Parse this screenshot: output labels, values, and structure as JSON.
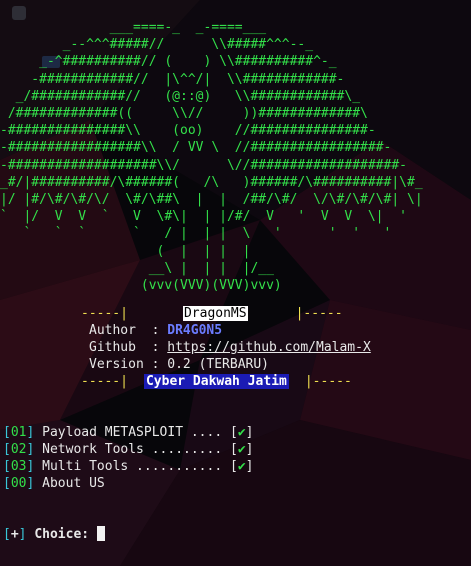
{
  "banner": {
    "art_lines": [
      "              ___====-_  _-====___",
      "        _--^^^#####//      \\\\#####^^^--_",
      "     _-^##########// (    ) \\\\##########^-_",
      "    -############//  |\\^^/|  \\\\############-",
      "  _/############//   (@::@)   \\\\############\\_",
      " /#############((     \\\\//     ))#############\\",
      "-###############\\\\    (oo)    //###############-",
      "-#################\\\\  / VV \\  //#################-",
      "-###################\\\\/      \\//###################-",
      "_#/|##########/\\######(   /\\   )######/\\##########|\\#_",
      "|/ |#/\\#/\\#/\\/  \\#/\\##\\  |  |  /##/\\#/  \\/\\#/\\#/\\#| \\|",
      "`  |/  V  V  `   V  \\#\\|  | |/#/  V   '  V  V  \\|  '",
      "   `   `  `      `   / |  | |  \\   '      '  '   '",
      "                    (  |  | |  |",
      "                   __\\ |  | |  |/__",
      "                  (vvv(VVV)(VVV)vvv)"
    ]
  },
  "info": {
    "dash_left": "-----|",
    "dash_right": "|-----",
    "title": "DragonMS",
    "author_label": "Author  : ",
    "author_value": "DR4G0N5",
    "github_label": "Github  : ",
    "github_value": "https://github.com/Malam-X",
    "version_text": "Version : 0.2 (TERBARU)",
    "team": "Cyber Dakwah Jatim"
  },
  "menu": [
    {
      "num": "01",
      "label": " Payload METASPLOIT .... ",
      "check": "✔"
    },
    {
      "num": "02",
      "label": " Network Tools ......... ",
      "check": "✔"
    },
    {
      "num": "03",
      "label": " Multi Tools ........... ",
      "check": "✔"
    },
    {
      "num": "00",
      "label": " About US",
      "check": ""
    }
  ],
  "prompt": {
    "marker": "+",
    "label": "Choice: "
  },
  "colors": {
    "background": "#07060a",
    "art_green": "#33e04a",
    "bracket_cyan": "#39c7d9",
    "author_blue": "#6b7cff",
    "team_box_blue": "#1b1bb4"
  }
}
